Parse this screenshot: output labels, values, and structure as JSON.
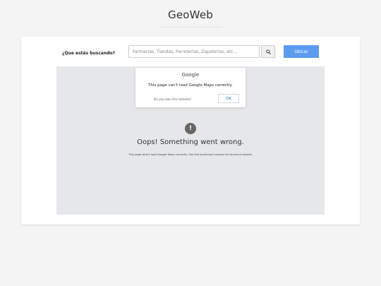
{
  "site": {
    "title": "GeoWeb"
  },
  "search": {
    "label": "¿Que estás buscando?",
    "placeholder": "Farmacias, Tiendas, Ferreterias, Zapaterias, etc...",
    "value": "",
    "search_icon": "search-icon",
    "locate_label": "Ubicar"
  },
  "map_error_dialog": {
    "brand": "Google",
    "message": "This page can't load Google Maps correctly.",
    "question": "Do you own this website?",
    "ok_label": "OK"
  },
  "map_error": {
    "icon": "!",
    "title": "Oops! Something went wrong.",
    "detail": "This page didn't load Google Maps correctly. See the JavaScript console for technical details."
  },
  "colors": {
    "accent": "#5b9cf0",
    "map_background": "#e6e7e9",
    "link_blue": "#1a73e8"
  }
}
